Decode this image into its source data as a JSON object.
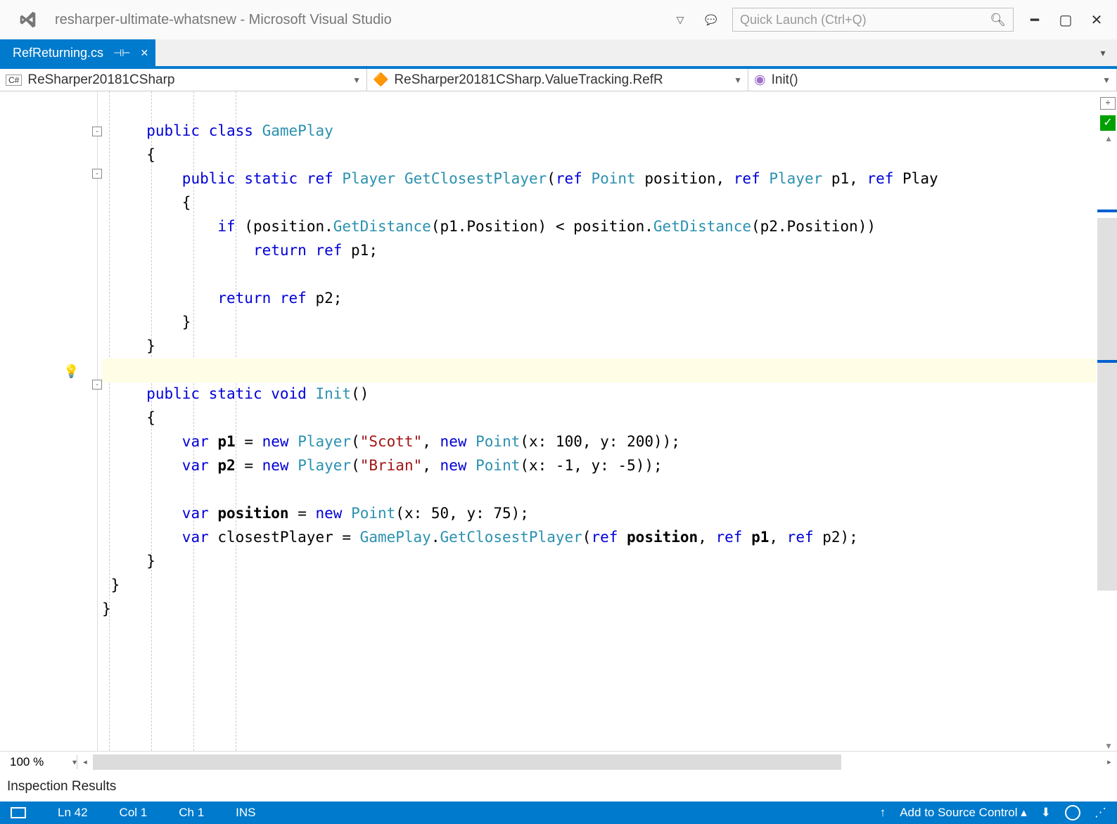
{
  "title": {
    "solution": "resharper-ultimate-whatsnew",
    "app": "Microsoft Visual Studio"
  },
  "quick_launch": {
    "placeholder": "Quick Launch (Ctrl+Q)"
  },
  "tab": {
    "file": "RefReturning.cs"
  },
  "nav": {
    "namespace": "ReSharper20181CSharp",
    "type": "ReSharper20181CSharp.ValueTracking.RefR",
    "member": "Init()"
  },
  "zoom": "100 %",
  "panel": "Inspection Results",
  "status": {
    "line": "Ln 42",
    "col": "Col 1",
    "ch": "Ch 1",
    "ins": "INS",
    "src": "Add to Source Control"
  },
  "code": {
    "class": "GamePlay",
    "method": "GetClosestPlayer",
    "init": "Init",
    "player": "Player",
    "point": "Point",
    "getdist": "GetDistance",
    "getclosest": "GetClosestPlayer",
    "s_scott": "\"Scott\"",
    "s_brian": "\"Brian\""
  }
}
